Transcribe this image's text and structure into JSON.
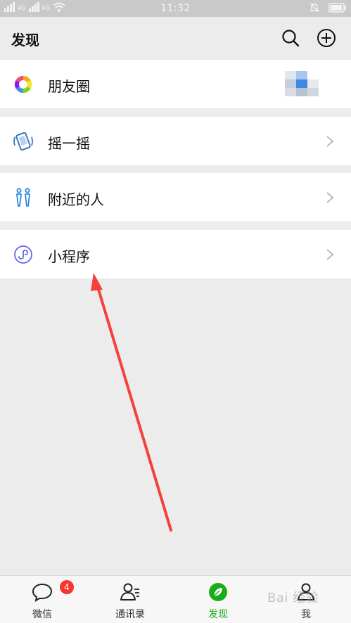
{
  "status_bar": {
    "time": "11:32",
    "signal_label_1": "4G",
    "signal_label_2": "4G"
  },
  "header": {
    "title": "发现"
  },
  "menu": {
    "moments": "朋友圈",
    "shake": "摇一摇",
    "nearby": "附近的人",
    "mini_programs": "小程序"
  },
  "tabs": [
    {
      "label": "微信",
      "badge": "4"
    },
    {
      "label": "通讯录"
    },
    {
      "label": "发现"
    },
    {
      "label": "我"
    }
  ],
  "watermark": "Bai 经验",
  "colors": {
    "accent": "#1aad19",
    "badge": "#f43530",
    "arrow": "#f2433a"
  }
}
